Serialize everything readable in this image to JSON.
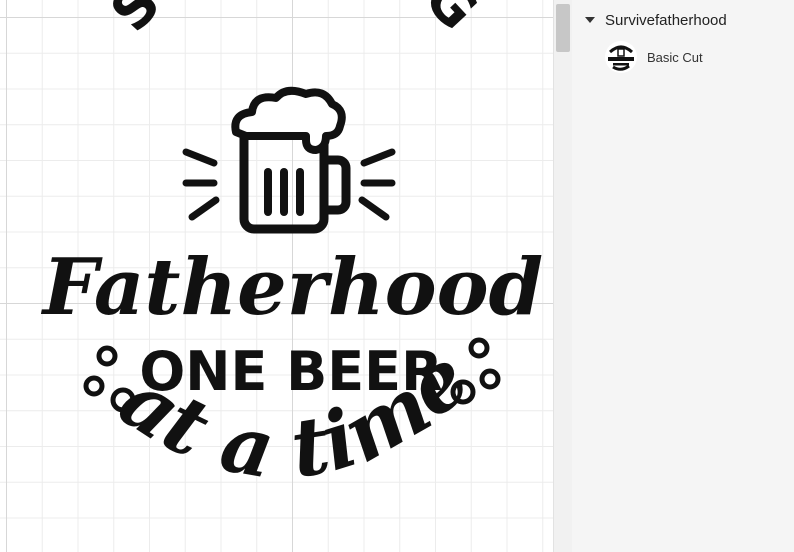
{
  "design": {
    "arc_text": "SURVIVING",
    "main_text": "Fatherhood",
    "sub_text": "ONE BEER",
    "bottom_text": "at a time",
    "ink_color": "#111111",
    "icon": "beer-mug-icon"
  },
  "layers_panel": {
    "group_name": "Survivefatherhood",
    "layers": [
      {
        "label": "Basic Cut",
        "thumbnail": "design-thumbnail-icon"
      }
    ]
  },
  "colors": {
    "canvas_background": "#ffffff",
    "grid_line": "#d7d7d7",
    "panel_background": "#f5f5f5"
  }
}
